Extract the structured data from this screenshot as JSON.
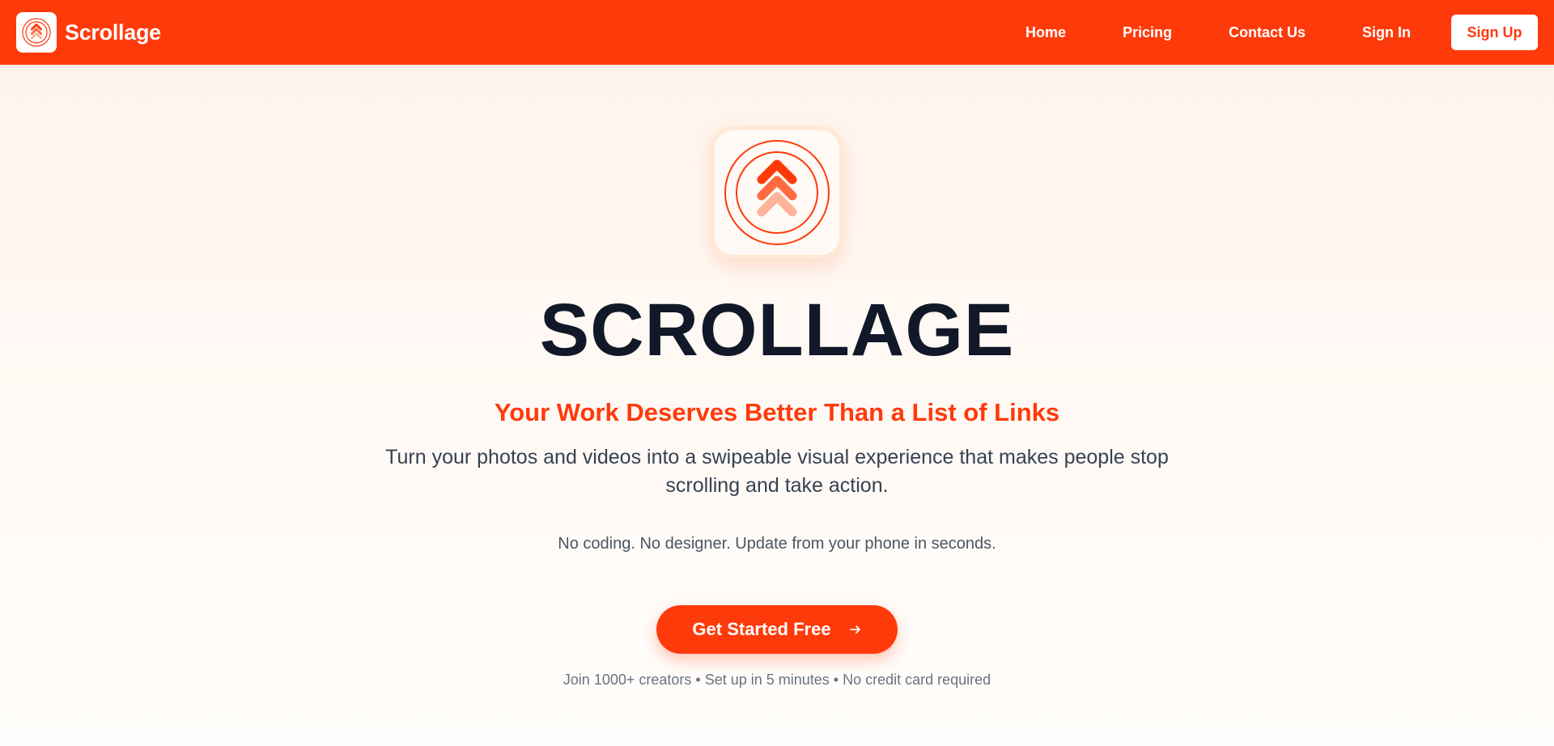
{
  "header": {
    "brand_name": "Scrollage",
    "nav": {
      "home": "Home",
      "pricing": "Pricing",
      "contact": "Contact Us",
      "sign_in": "Sign In",
      "sign_up": "Sign Up"
    }
  },
  "hero": {
    "title": "SCROLLAGE",
    "tagline": "Your Work Deserves Better Than a List of Links",
    "description": "Turn your photos and videos into a swipeable visual experience that makes people stop scrolling and take action.",
    "note": "No coding. No designer. Update from your phone in seconds.",
    "cta_label": "Get Started Free",
    "trust_line": "Join 1000+ creators • Set up in 5 minutes • No credit card required"
  },
  "icons": {
    "brand_logo": "scrollage-chevrons-logo-icon",
    "hero_logo": "scrollage-chevrons-logo-icon",
    "cta_arrow": "arrow-right-icon"
  },
  "colors": {
    "brand": "#ff3a0a",
    "chevron_mid": "#ff6a40",
    "chevron_light": "#ffb39a",
    "title": "#111827",
    "body_text": "#374151",
    "muted_text": "#6b7280"
  }
}
